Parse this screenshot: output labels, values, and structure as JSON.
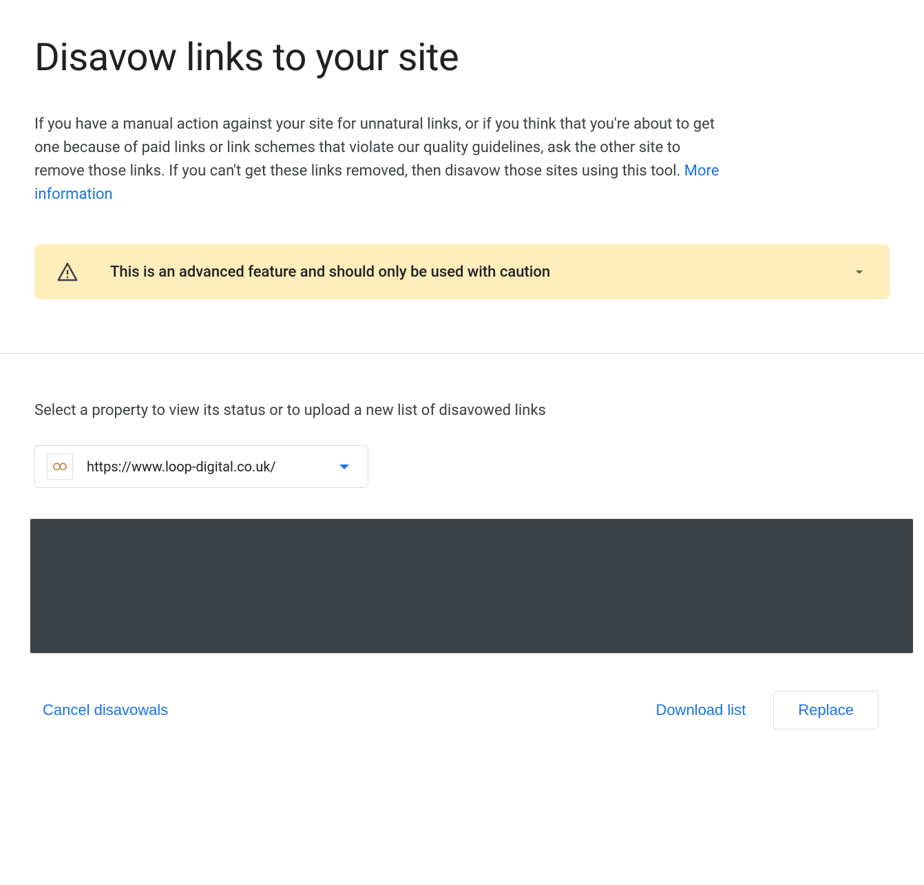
{
  "header": {
    "title": "Disavow links to your site",
    "description": "If you have a manual action against your site for unnatural links, or if you think that you're about to get one because of paid links or link schemes that violate our quality guidelines, ask the other site to remove those links. If you can't get these links removed, then disavow those sites using this tool. ",
    "more_info_label": "More information"
  },
  "warning": {
    "text": "This is an advanced feature and should only be used with caution"
  },
  "property_section": {
    "label": "Select a property to view its status or to upload a new list of disavowed links",
    "selected_url": "https://www.loop-digital.co.uk/"
  },
  "actions": {
    "cancel_label": "Cancel disavowals",
    "download_label": "Download list",
    "replace_label": "Replace"
  }
}
